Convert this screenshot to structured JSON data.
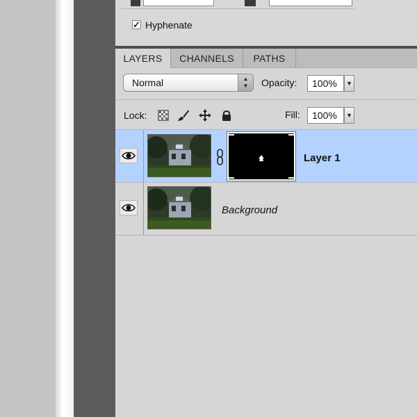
{
  "paragraph": {
    "hyphenate_label": "Hyphenate",
    "hyphenate_checked": true
  },
  "tabs": [
    {
      "label": "LAYERS",
      "active": true
    },
    {
      "label": "CHANNELS",
      "active": false
    },
    {
      "label": "PATHS",
      "active": false
    }
  ],
  "blend": {
    "mode": "Normal",
    "opacity_label": "Opacity:",
    "opacity_value": "100%"
  },
  "lock": {
    "label": "Lock:",
    "fill_label": "Fill:",
    "fill_value": "100%"
  },
  "layers": [
    {
      "name": "Layer 1",
      "selected": true,
      "has_mask": true,
      "visible": true
    },
    {
      "name": "Background",
      "selected": false,
      "has_mask": false,
      "visible": true
    }
  ],
  "colors": {
    "selection": "#b4d2ff",
    "panel": "#d6d6d6",
    "tabbar": "#bcbcbc",
    "separator": "#4d4d4d"
  }
}
